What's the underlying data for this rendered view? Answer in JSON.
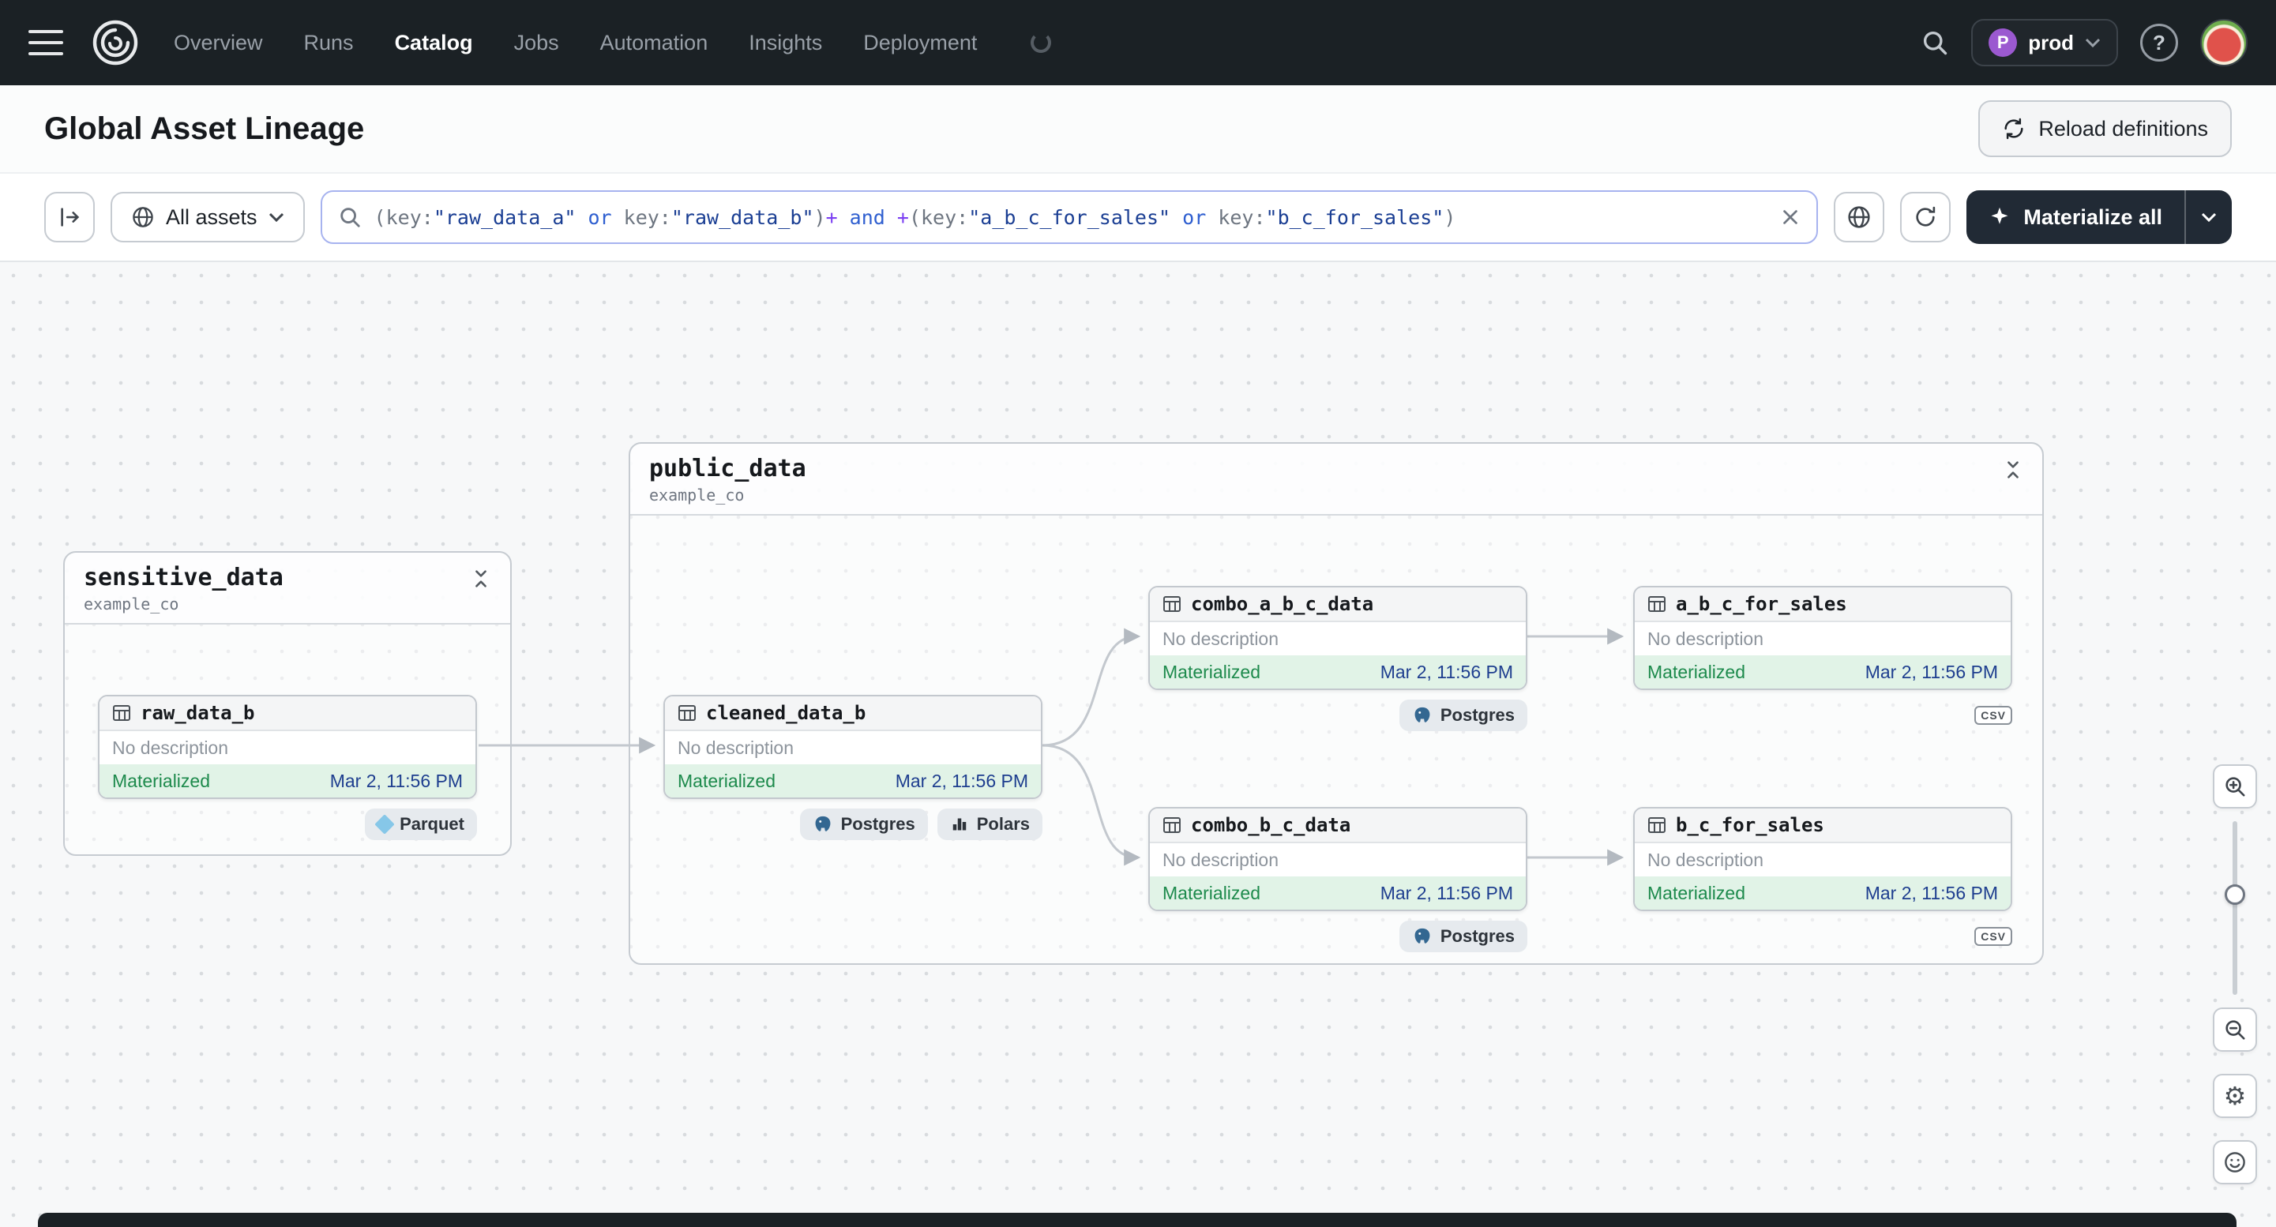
{
  "colors": {
    "nav_bg": "#1b2125",
    "status_green_bg": "#e1f3e7",
    "status_green_text": "#1d8a4c",
    "timestamp_blue": "#1e3e8f",
    "canvas_bg": "#f7f8f9",
    "query_string": "#1a3e93",
    "query_keyword": "#2f5fd0",
    "query_operator": "#7b3ff2",
    "query_punctuation": "#6d7580"
  },
  "nav": {
    "items": [
      "Overview",
      "Runs",
      "Catalog",
      "Jobs",
      "Automation",
      "Insights",
      "Deployment"
    ],
    "active_item": "Catalog",
    "deployment": {
      "initial": "P",
      "name": "prod"
    },
    "help": "?"
  },
  "header": {
    "title": "Global Asset Lineage",
    "reload_button": "Reload definitions"
  },
  "toolbar": {
    "scope_button": "All assets",
    "materialize_button": "Materialize all",
    "query_tokens": [
      {
        "t": "(key:"
      },
      {
        "t": "\"raw_data_a\""
      },
      {
        "t": " or "
      },
      {
        "t": "key:"
      },
      {
        "t": "\"raw_data_b\""
      },
      {
        "t": ")"
      },
      {
        "t": "+"
      },
      {
        "t": " and "
      },
      {
        "t": "+"
      },
      {
        "t": "(key:"
      },
      {
        "t": "\"a_b_c_for_sales\""
      },
      {
        "t": " or "
      },
      {
        "t": "key:"
      },
      {
        "t": "\"b_c_for_sales\""
      },
      {
        "t": ")"
      }
    ]
  },
  "graph": {
    "groups": [
      {
        "name": "sensitive_data",
        "location": "example_co"
      },
      {
        "name": "public_data",
        "location": "example_co"
      }
    ],
    "nodes": [
      {
        "name": "raw_data_b",
        "description": "No description",
        "status": "Materialized",
        "timestamp": "Mar 2, 11:56 PM",
        "tags": [
          {
            "label": "Parquet"
          }
        ]
      },
      {
        "name": "cleaned_data_b",
        "description": "No description",
        "status": "Materialized",
        "timestamp": "Mar 2, 11:56 PM",
        "tags": [
          {
            "label": "Postgres"
          },
          {
            "label": "Polars"
          }
        ]
      },
      {
        "name": "combo_a_b_c_data",
        "description": "No description",
        "status": "Materialized",
        "timestamp": "Mar 2, 11:56 PM",
        "tags": [
          {
            "label": "Postgres"
          }
        ]
      },
      {
        "name": "combo_b_c_data",
        "description": "No description",
        "status": "Materialized",
        "timestamp": "Mar 2, 11:56 PM",
        "tags": [
          {
            "label": "Postgres"
          }
        ]
      },
      {
        "name": "a_b_c_for_sales",
        "description": "No description",
        "status": "Materialized",
        "timestamp": "Mar 2, 11:56 PM",
        "tags": [
          {
            "label": "csv"
          }
        ]
      },
      {
        "name": "b_c_for_sales",
        "description": "No description",
        "status": "Materialized",
        "timestamp": "Mar 2, 11:56 PM",
        "tags": [
          {
            "label": "csv"
          }
        ]
      }
    ]
  }
}
